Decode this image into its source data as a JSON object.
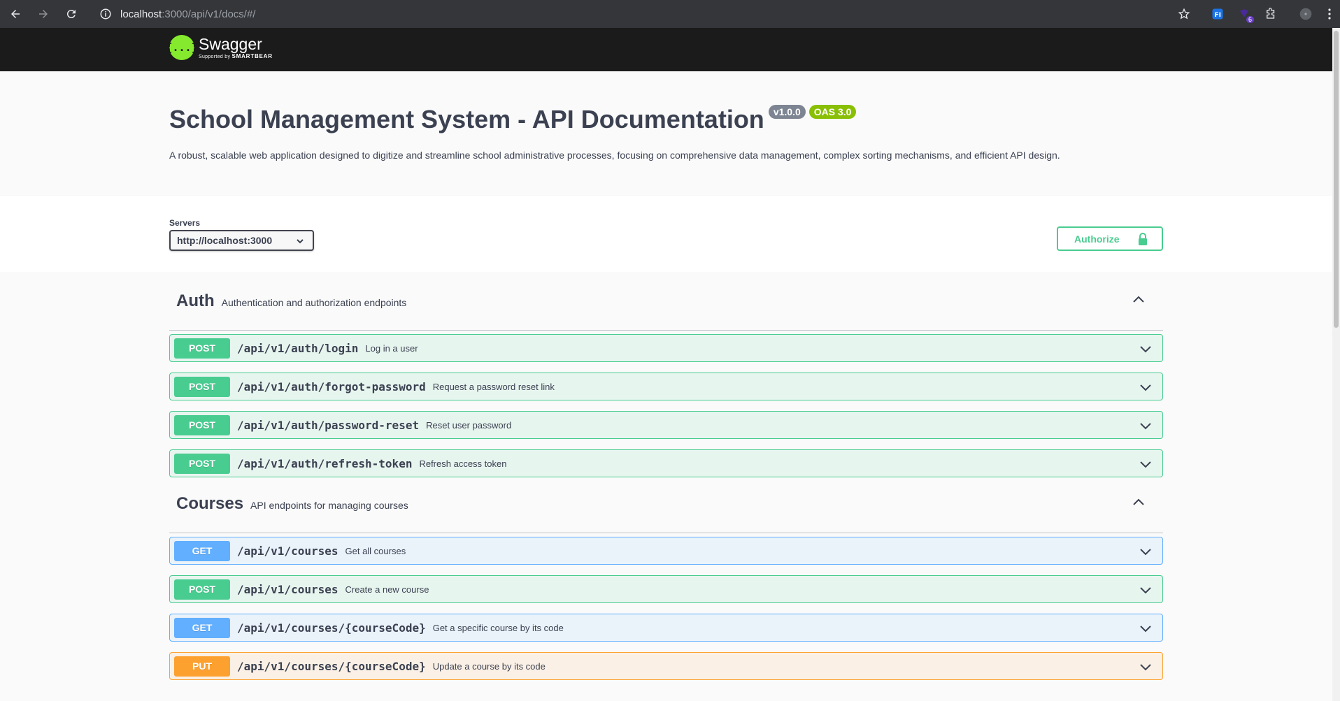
{
  "browser": {
    "url_host": "localhost",
    "url_path": ":3000/api/v1/docs/#/",
    "extension_badge": "6",
    "icons": [
      "back-icon",
      "forward-icon",
      "reload-icon",
      "info-icon",
      "star-icon",
      "ext-fi-icon",
      "ext-badge-icon",
      "puzzle-icon",
      "profile-icon",
      "menu-icon"
    ]
  },
  "topbar": {
    "logo_mark": "{...}",
    "logo_name": "Swagger",
    "logo_sub_prefix": "Supported by",
    "logo_sub_brand": "SMARTBEAR"
  },
  "info": {
    "title": "School Management System - API Documentation",
    "version": "v1.0.0",
    "oas": "OAS 3.0",
    "description": "A robust, scalable web application designed to digitize and streamline school administrative processes, focusing on comprehensive data management, complex sorting mechanisms, and efficient API design."
  },
  "servers": {
    "label": "Servers",
    "selected": "http://localhost:3000"
  },
  "authorize": {
    "label": "Authorize"
  },
  "tags": [
    {
      "name": "Auth",
      "description": "Authentication and authorization endpoints",
      "operations": [
        {
          "method": "POST",
          "path": "/api/v1/auth/login",
          "summary": "Log in a user"
        },
        {
          "method": "POST",
          "path": "/api/v1/auth/forgot-password",
          "summary": "Request a password reset link"
        },
        {
          "method": "POST",
          "path": "/api/v1/auth/password-reset",
          "summary": "Reset user password"
        },
        {
          "method": "POST",
          "path": "/api/v1/auth/refresh-token",
          "summary": "Refresh access token"
        }
      ]
    },
    {
      "name": "Courses",
      "description": "API endpoints for managing courses",
      "operations": [
        {
          "method": "GET",
          "path": "/api/v1/courses",
          "summary": "Get all courses"
        },
        {
          "method": "POST",
          "path": "/api/v1/courses",
          "summary": "Create a new course"
        },
        {
          "method": "GET",
          "path": "/api/v1/courses/{courseCode}",
          "summary": "Get a specific course by its code"
        },
        {
          "method": "PUT",
          "path": "/api/v1/courses/{courseCode}",
          "summary": "Update a course by its code"
        }
      ]
    }
  ],
  "colors": {
    "post": "#49cc90",
    "get": "#61affe",
    "put": "#fca130",
    "topbar": "#1b1b1b",
    "logo": "#85ea2d"
  }
}
